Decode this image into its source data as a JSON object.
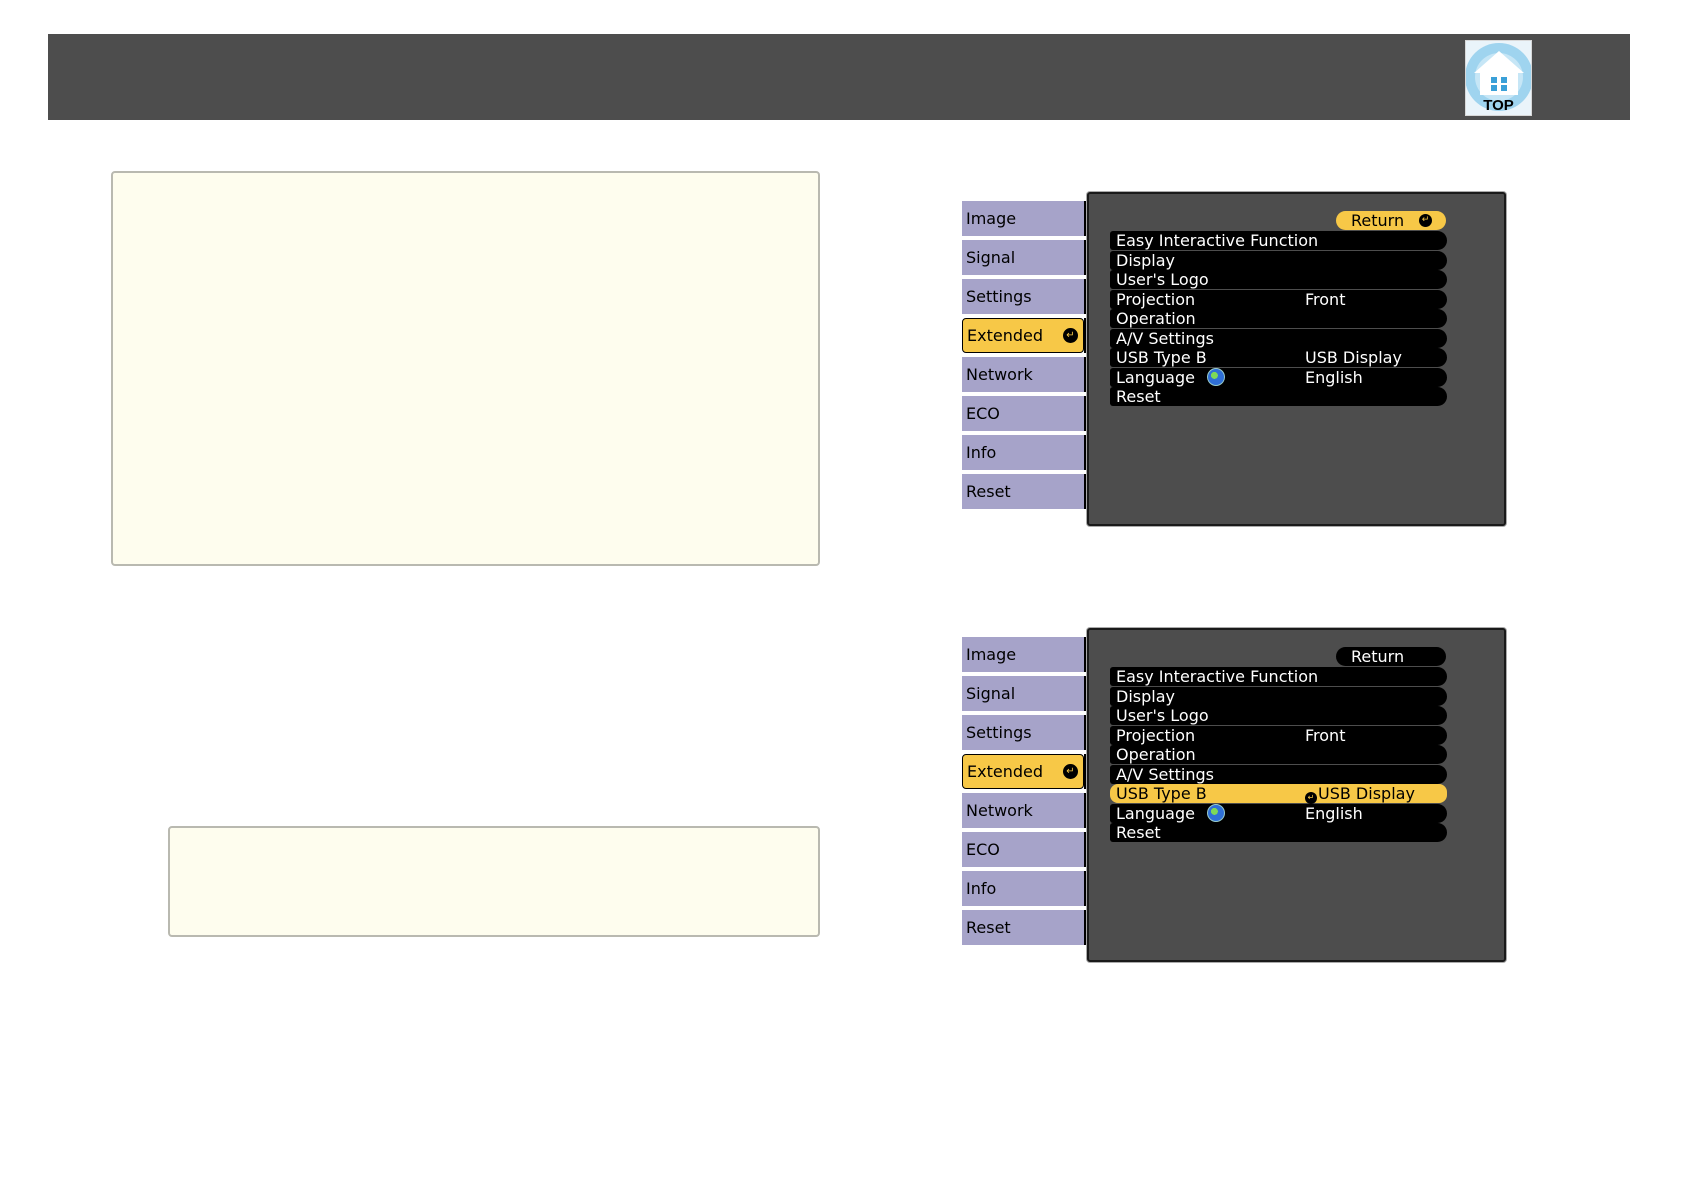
{
  "header": {
    "top_button_label": "TOP"
  },
  "menu_screens": [
    {
      "tabs": [
        {
          "label": "Image",
          "active": false
        },
        {
          "label": "Signal",
          "active": false
        },
        {
          "label": "Settings",
          "active": false
        },
        {
          "label": "Extended",
          "active": true
        },
        {
          "label": "Network",
          "active": false
        },
        {
          "label": "ECO",
          "active": false
        },
        {
          "label": "Info",
          "active": false
        },
        {
          "label": "Reset",
          "active": false
        }
      ],
      "return_label": "Return",
      "return_highlighted": true,
      "items": [
        {
          "label": "Easy Interactive Function",
          "value": ""
        },
        {
          "label": "Display",
          "value": ""
        },
        {
          "label": "User's Logo",
          "value": ""
        },
        {
          "label": "Projection",
          "value": "Front"
        },
        {
          "label": "Operation",
          "value": ""
        },
        {
          "label": "A/V Settings",
          "value": ""
        },
        {
          "label": "USB Type B",
          "value": "USB Display"
        },
        {
          "label": "Language",
          "value": "English",
          "icon": "globe-icon"
        },
        {
          "label": "Reset",
          "value": ""
        }
      ],
      "highlighted_item": -1
    },
    {
      "tabs": [
        {
          "label": "Image",
          "active": false
        },
        {
          "label": "Signal",
          "active": false
        },
        {
          "label": "Settings",
          "active": false
        },
        {
          "label": "Extended",
          "active": true
        },
        {
          "label": "Network",
          "active": false
        },
        {
          "label": "ECO",
          "active": false
        },
        {
          "label": "Info",
          "active": false
        },
        {
          "label": "Reset",
          "active": false
        }
      ],
      "return_label": "Return",
      "return_highlighted": false,
      "items": [
        {
          "label": "Easy Interactive Function",
          "value": ""
        },
        {
          "label": "Display",
          "value": ""
        },
        {
          "label": "User's Logo",
          "value": ""
        },
        {
          "label": "Projection",
          "value": "Front"
        },
        {
          "label": "Operation",
          "value": ""
        },
        {
          "label": "A/V Settings",
          "value": ""
        },
        {
          "label": "USB Type B",
          "value": "USB Display"
        },
        {
          "label": "Language",
          "value": "English",
          "icon": "globe-icon"
        },
        {
          "label": "Reset",
          "value": ""
        }
      ],
      "highlighted_item": 6
    }
  ],
  "colors": {
    "header_bg": "#4d4d4d",
    "note_bg": "#fefdee",
    "tab_bg": "#a6a3c9",
    "highlight": "#f7c847",
    "panel_bg": "#4d4d4d"
  }
}
